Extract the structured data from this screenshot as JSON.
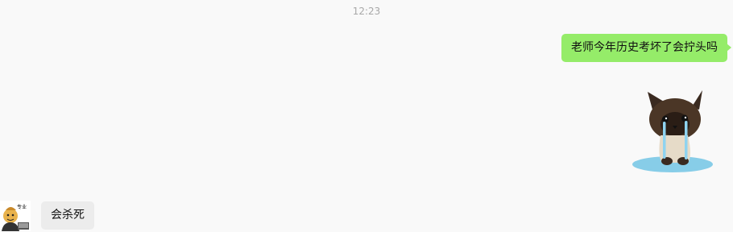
{
  "timestamp": "12:23",
  "messages": {
    "outgoing_text": "老师今年历史考坏了会拧头吗",
    "outgoing_sticker_icon": "crying-siamese-cat-sticker",
    "incoming_text": "会杀死"
  },
  "avatar": {
    "icon": "cartoon-character-avatar",
    "caption": "专业"
  },
  "colors": {
    "outgoing_bubble": "#95ec69",
    "incoming_bubble": "#ececec",
    "background": "#f9f9f9",
    "timestamp": "#a8a8a8"
  }
}
